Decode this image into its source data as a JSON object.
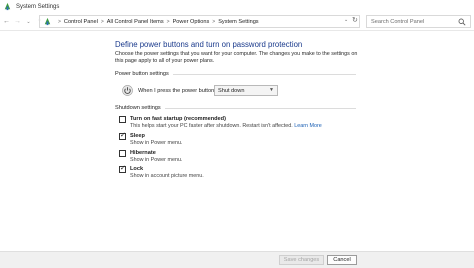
{
  "window": {
    "title": "System Settings"
  },
  "nav": {
    "back": "←",
    "forward": "→",
    "dropdown": "⌄",
    "up": "↑",
    "refresh": "↻"
  },
  "breadcrumb": {
    "items": [
      "Control Panel",
      "All Control Panel Items",
      "Power Options",
      "System Settings"
    ],
    "separator": ">"
  },
  "search": {
    "placeholder": "Search Control Panel"
  },
  "page": {
    "title": "Define power buttons and turn on password protection",
    "intro": "Choose the power settings that you want for your computer. The changes you make to the settings on this page apply to all of your power plans."
  },
  "power_button_settings": {
    "section_title": "Power button settings",
    "label": "When I press the power button:",
    "selected": "Shut down"
  },
  "shutdown_settings": {
    "section_title": "Shutdown settings",
    "options": [
      {
        "title": "Turn on fast startup (recommended)",
        "desc": "This helps start your PC faster after shutdown. Restart isn't affected.",
        "link": "Learn More",
        "checked": false
      },
      {
        "title": "Sleep",
        "desc": "Show in Power menu.",
        "checked": true
      },
      {
        "title": "Hibernate",
        "desc": "Show in Power menu.",
        "checked": false
      },
      {
        "title": "Lock",
        "desc": "Show in account picture menu.",
        "checked": true
      }
    ]
  },
  "footer": {
    "save_label": "Save changes",
    "cancel_label": "Cancel"
  },
  "colors": {
    "title_blue": "#1a3a8c",
    "link_blue": "#1a5fb4"
  }
}
